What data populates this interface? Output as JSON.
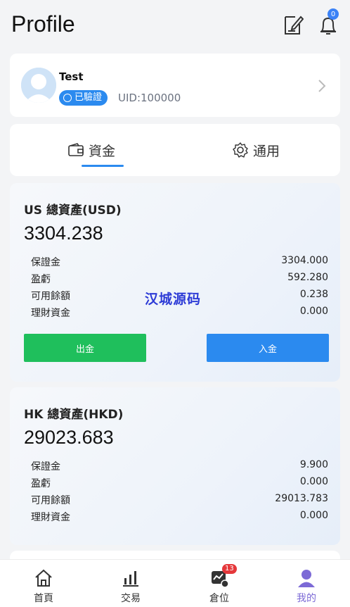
{
  "header": {
    "title": "Profile",
    "notification_count": "0"
  },
  "profile": {
    "name": "Test",
    "verified_label": "已驗證",
    "uid": "UID:100000"
  },
  "tabs": [
    {
      "label": "資金",
      "icon": "wallet-icon",
      "active": true
    },
    {
      "label": "通用",
      "icon": "gear-icon",
      "active": false
    }
  ],
  "accounts": [
    {
      "title": "US 總資產(USD)",
      "total": "3304.238",
      "rows": [
        {
          "label": "保證金",
          "value": "3304.000"
        },
        {
          "label": "盈虧",
          "value": "592.280"
        },
        {
          "label": "可用餘額",
          "value": "0.238"
        },
        {
          "label": "理財資金",
          "value": "0.000"
        }
      ],
      "withdraw_label": "出金",
      "deposit_label": "入金"
    },
    {
      "title": "HK 總資產(HKD)",
      "total": "29023.683",
      "rows": [
        {
          "label": "保證金",
          "value": "9.900"
        },
        {
          "label": "盈虧",
          "value": "0.000"
        },
        {
          "label": "可用餘額",
          "value": "29013.783"
        },
        {
          "label": "理財資金",
          "value": "0.000"
        }
      ]
    }
  ],
  "watermark": "汉城源码",
  "nav": [
    {
      "label": "首頁",
      "icon": "home-icon"
    },
    {
      "label": "交易",
      "icon": "bar-chart-icon"
    },
    {
      "label": "倉位",
      "icon": "position-icon",
      "badge": "13"
    },
    {
      "label": "我的",
      "icon": "user-icon",
      "active": true
    }
  ],
  "colors": {
    "accent": "#2b8aef",
    "withdraw": "#1fbf5c",
    "deposit": "#2b8aef",
    "active_nav": "#7c6ad6",
    "badge": "#e5383b"
  }
}
